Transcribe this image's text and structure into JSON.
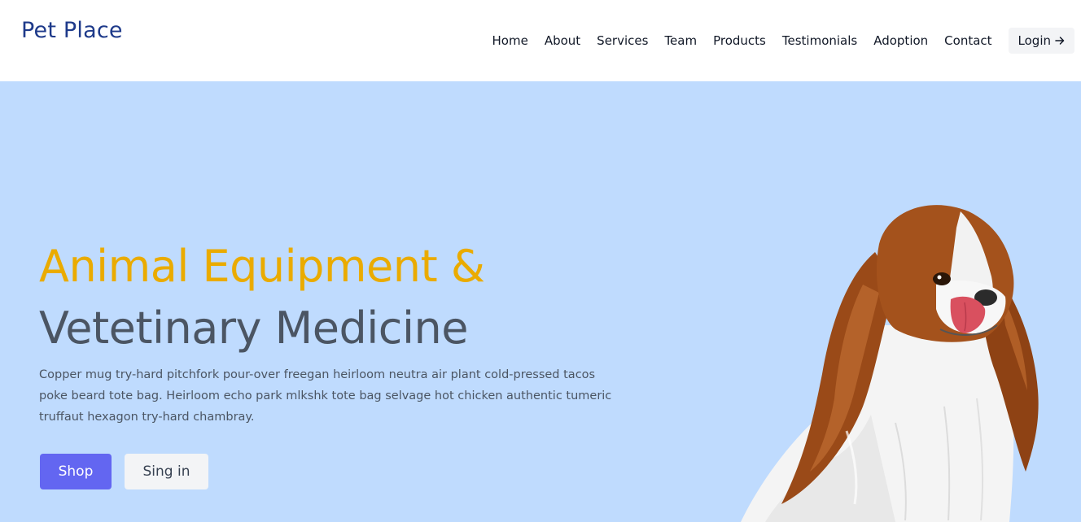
{
  "brand": {
    "name": "Pet Place",
    "color": "#1e3a8a"
  },
  "nav": {
    "items": [
      {
        "label": "Home"
      },
      {
        "label": "About"
      },
      {
        "label": "Services"
      },
      {
        "label": "Team"
      },
      {
        "label": "Products"
      },
      {
        "label": "Testimonials"
      },
      {
        "label": "Adoption"
      },
      {
        "label": "Contact"
      }
    ],
    "login_label": "Login",
    "login_icon": "arrow-right-icon"
  },
  "hero": {
    "title_line1": "Animal Equipment &",
    "title_line2": "Vetetinary Medicine",
    "description": "Copper mug try-hard pitchfork pour-over freegan heirloom neutra air plant cold-pressed tacos poke beard tote bag. Heirloom echo park mlkshk tote bag selvage hot chicken authentic tumeric truffaut hexagon try-hard chambray.",
    "primary_button": "Shop",
    "secondary_button": "Sing in",
    "image": "dog-image",
    "colors": {
      "background": "#bfdbfe",
      "title_accent": "#eaab00",
      "title_dark": "#4b5563",
      "primary_button": "#6366f1"
    }
  }
}
